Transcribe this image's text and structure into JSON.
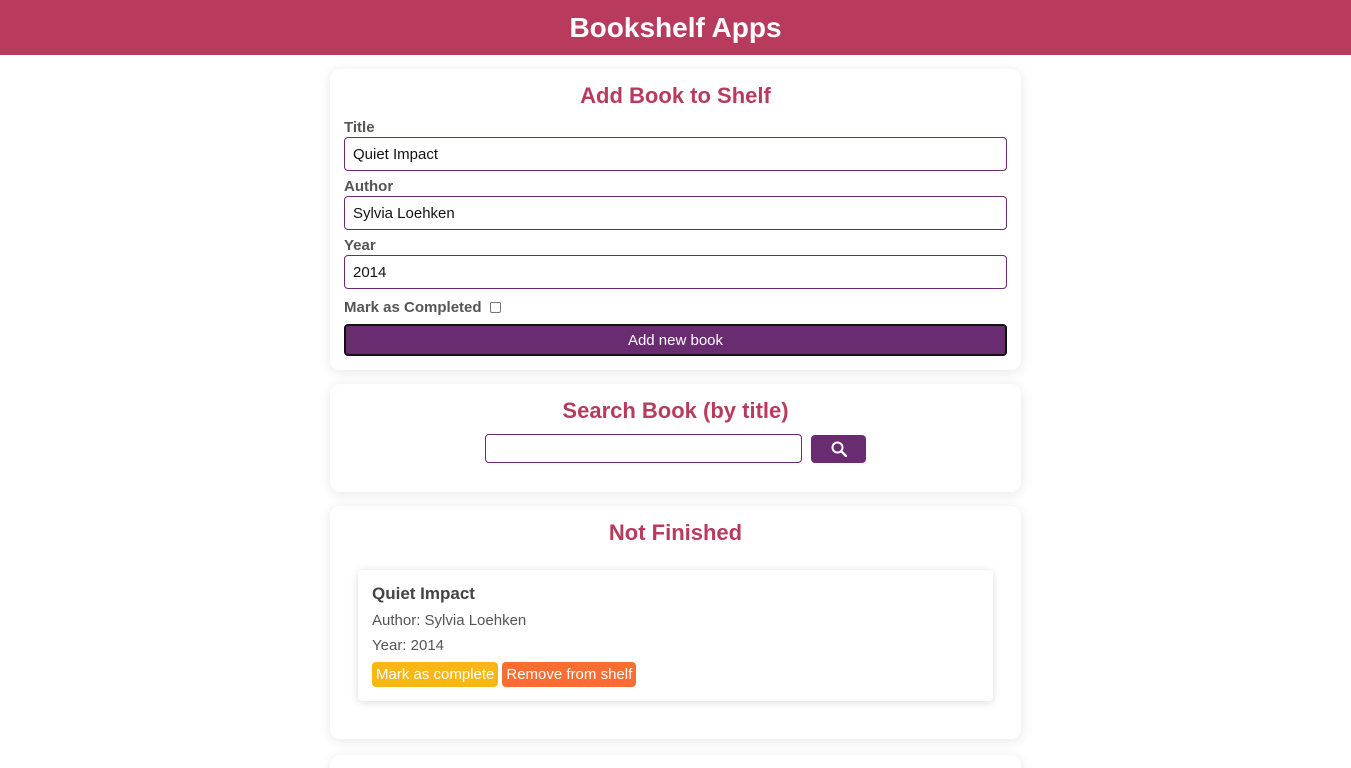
{
  "header": {
    "title": "Bookshelf Apps"
  },
  "add_form": {
    "heading": "Add Book to Shelf",
    "title_label": "Title",
    "title_value": "Quiet Impact",
    "author_label": "Author",
    "author_value": "Sylvia Loehken",
    "year_label": "Year",
    "year_value": "2014",
    "completed_label": "Mark as Completed",
    "completed_checked": false,
    "submit_label": "Add new book"
  },
  "search": {
    "heading": "Search Book (by title)",
    "value": "",
    "icon": "search-icon"
  },
  "not_finished": {
    "heading": "Not Finished",
    "books": [
      {
        "title": "Quiet Impact",
        "author": "Author: Sylvia Loehken",
        "year": "Year: 2014",
        "complete_label": "Mark as complete",
        "remove_label": "Remove from shelf"
      }
    ]
  },
  "colors": {
    "header": "#b83b5e",
    "primary": "#6a2c70",
    "complete_button": "#f9b614",
    "remove_button": "#f96d30"
  }
}
